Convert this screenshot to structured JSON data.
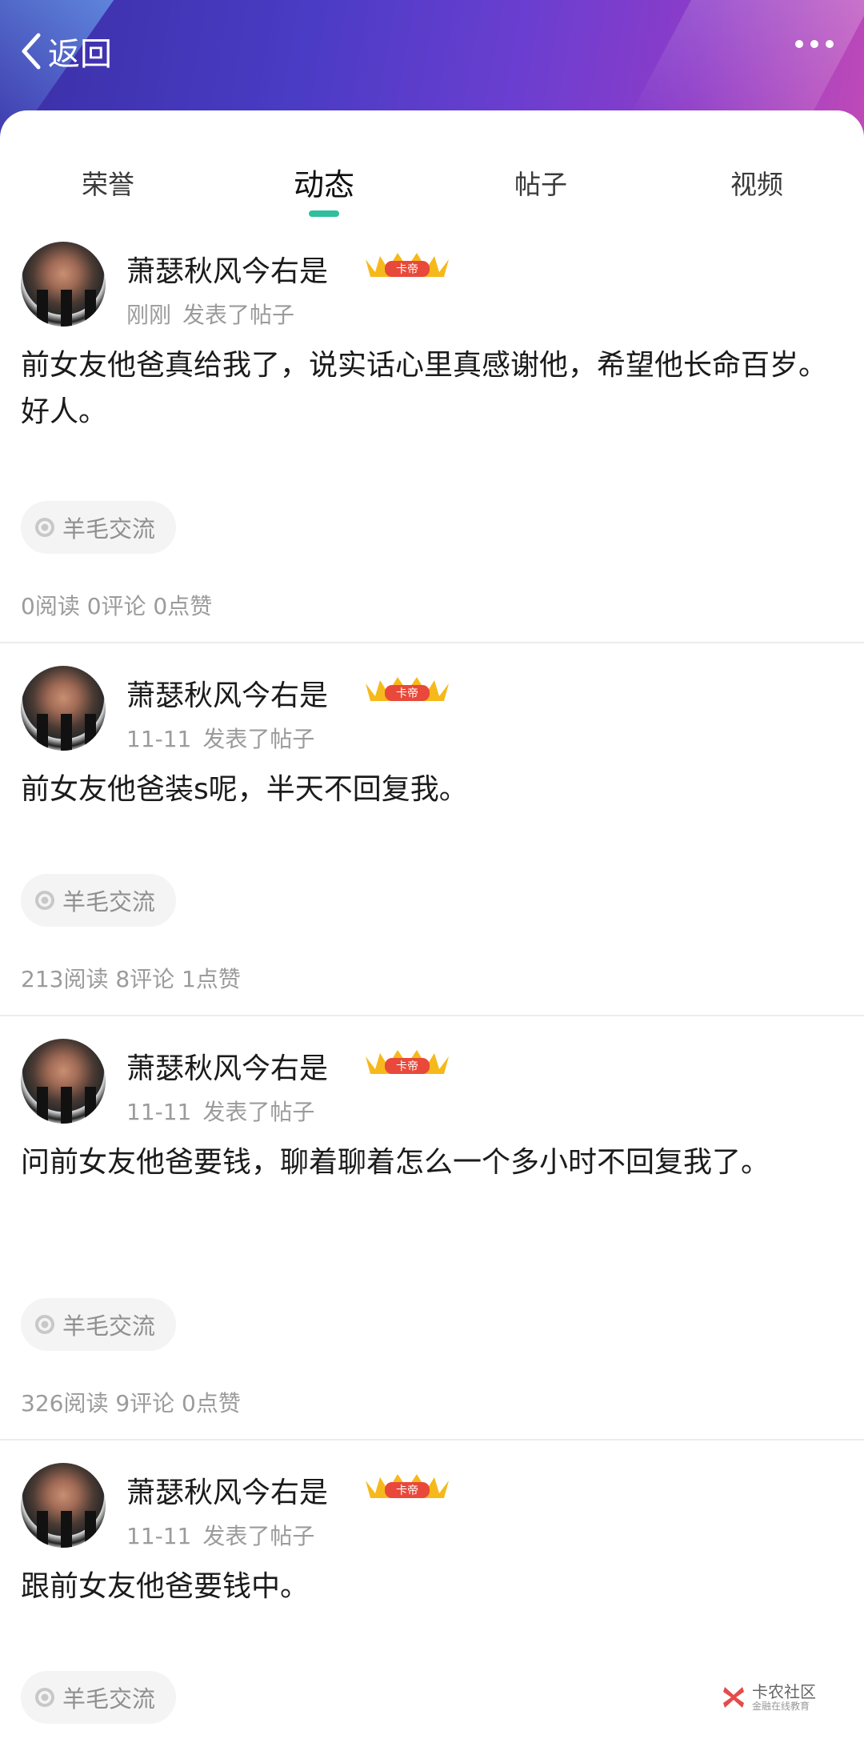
{
  "header": {
    "back_label": "返回"
  },
  "tabs": [
    {
      "label": "荣誉"
    },
    {
      "label": "动态"
    },
    {
      "label": "帖子"
    },
    {
      "label": "视频"
    }
  ],
  "badge_text": "卡帝",
  "posts": [
    {
      "username": "萧瑟秋风今右是",
      "time": "刚刚",
      "action": "发表了帖子",
      "content": "前女友他爸真给我了，说实话心里真感谢他，希望他长命百岁。好人。",
      "tag": "羊毛交流",
      "stats": "0阅读 0评论 0点赞"
    },
    {
      "username": "萧瑟秋风今右是",
      "time": "11-11",
      "action": "发表了帖子",
      "content": "前女友他爸装s呢，半天不回复我。",
      "tag": "羊毛交流",
      "stats": "213阅读 8评论 1点赞"
    },
    {
      "username": "萧瑟秋风今右是",
      "time": "11-11",
      "action": "发表了帖子",
      "content": "问前女友他爸要钱，聊着聊着怎么一个多小时不回复我了。",
      "tag": "羊毛交流",
      "stats": "326阅读 9评论 0点赞"
    },
    {
      "username": "萧瑟秋风今右是",
      "time": "11-11",
      "action": "发表了帖子",
      "content": "跟前女友他爸要钱中。",
      "tag": "羊毛交流"
    }
  ],
  "watermark": {
    "title": "卡农社区",
    "subtitle": "金融在线教育"
  }
}
